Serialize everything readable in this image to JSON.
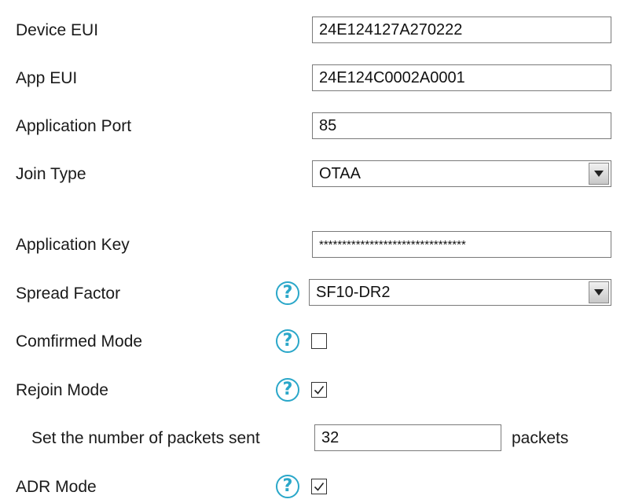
{
  "fields": {
    "device_eui": {
      "label": "Device EUI",
      "value": "24E124127A270222"
    },
    "app_eui": {
      "label": "App EUI",
      "value": "24E124C0002A0001"
    },
    "application_port": {
      "label": "Application Port",
      "value": "85"
    },
    "join_type": {
      "label": "Join Type",
      "value": "OTAA"
    },
    "application_key": {
      "label": "Application Key",
      "value": "********************************"
    },
    "spread_factor": {
      "label": "Spread Factor",
      "value": "SF10-DR2"
    },
    "confirmed_mode": {
      "label": "Comfirmed Mode",
      "checked": false
    },
    "rejoin_mode": {
      "label": "Rejoin Mode",
      "checked": true
    },
    "packets_sent": {
      "label": "Set the number of packets sent",
      "value": "32",
      "unit": "packets"
    },
    "adr_mode": {
      "label": "ADR Mode",
      "checked": true
    }
  },
  "icons": {
    "help": "help-icon",
    "help_glyph": "?",
    "help_color": "#2aa7c9"
  }
}
